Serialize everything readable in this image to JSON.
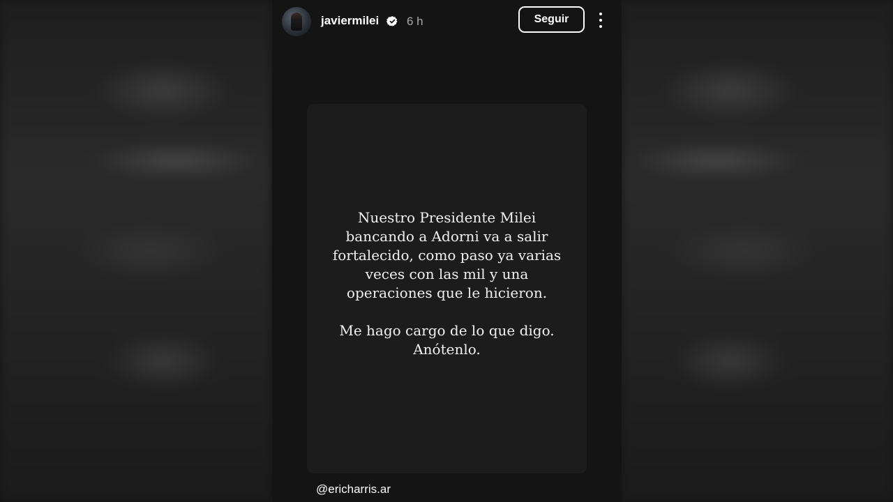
{
  "header": {
    "username": "javiermilei",
    "verified_icon": "verified-badge-icon",
    "timestamp": "6 h",
    "follow_label": "Seguir",
    "more_icon": "more-options-icon"
  },
  "story": {
    "paragraph_1": "Nuestro Presidente Milei\nbancando a Adorni va a salir\nfortalecido, como paso ya varias\nveces con las mil y una\noperaciones que le hicieron.",
    "paragraph_2": "Me hago cargo de lo que digo.\nAnótenlo.",
    "mention": "@ericharris.ar"
  },
  "colors": {
    "background": "#141414",
    "card": "#1c1c1c",
    "text": "#ffffff",
    "muted": "#a8a8a8"
  }
}
